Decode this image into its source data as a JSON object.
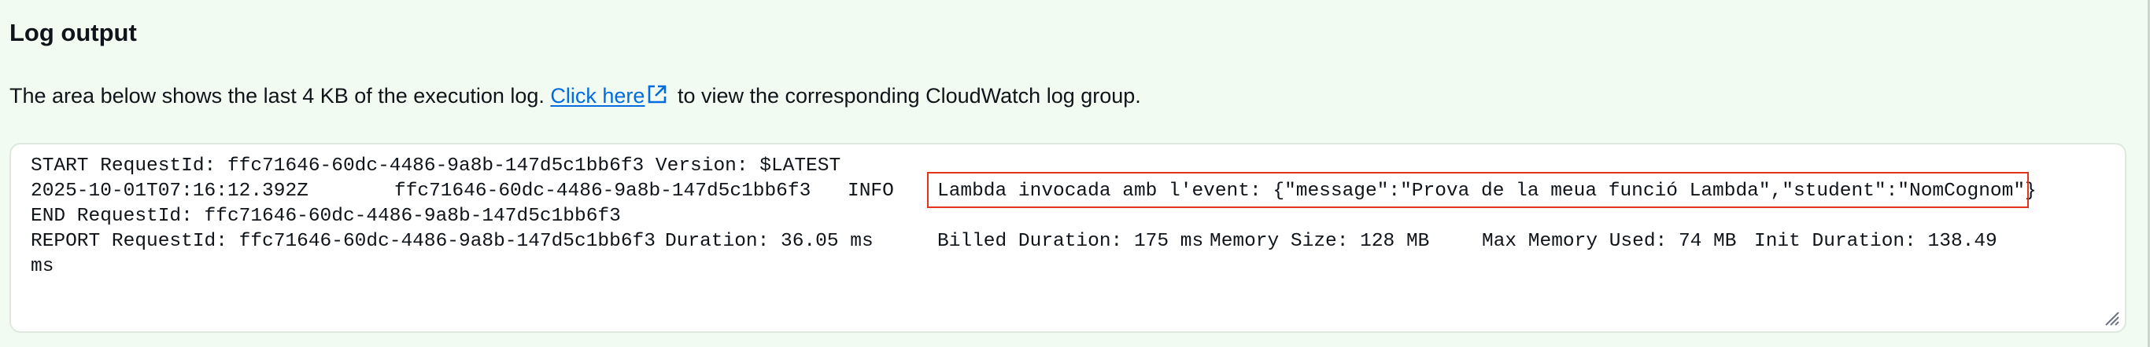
{
  "section": {
    "title": "Log output",
    "description_before": "The area below shows the last 4 KB of the execution log. ",
    "link_text": "Click here",
    "description_after": " to view the corresponding CloudWatch log group."
  },
  "log": {
    "line1": "START RequestId: ffc71646-60dc-4486-9a8b-147d5c1bb6f3 Version: $LATEST",
    "line2_timestamp": "2025-10-01T07:16:12.392Z",
    "line2_request_id": "ffc71646-60dc-4486-9a8b-147d5c1bb6f3",
    "line2_level": "INFO",
    "line2_message": "Lambda invocada amb l'event: {\"message\":\"Prova de la meua funció Lambda\",\"student\":\"NomCognom\"}",
    "line3": "END RequestId: ffc71646-60dc-4486-9a8b-147d5c1bb6f3",
    "line4_request_id": "REPORT RequestId: ffc71646-60dc-4486-9a8b-147d5c1bb6f3",
    "line4_duration": "Duration: 36.05 ms",
    "line4_billed": "Billed Duration: 175 ms",
    "line4_memory": "Memory Size: 128 MB",
    "line4_max_memory": "Max Memory Used: 74 MB",
    "line4_init": "Init Duration: 138.49",
    "line5": "ms"
  },
  "colors": {
    "background": "#f2fbf2",
    "link": "#006ce0",
    "highlight_border": "#e0351c"
  },
  "icons": {
    "external_link": "external-link-icon",
    "resize": "resize-handle-icon"
  }
}
